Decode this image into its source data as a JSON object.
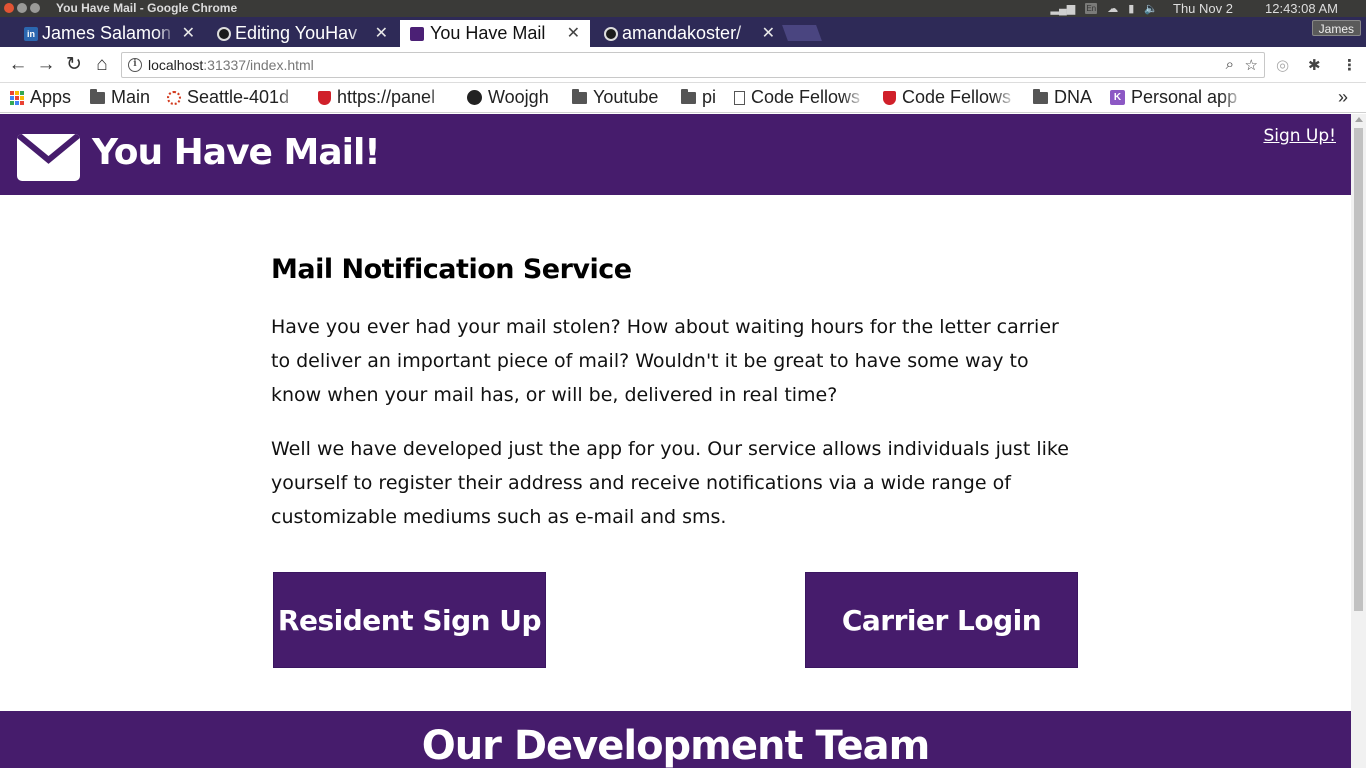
{
  "os": {
    "window_title": "You Have Mail - Google Chrome",
    "keyboard": "En",
    "date": "Thu Nov  2",
    "time": "12:43:08 AM"
  },
  "browser": {
    "tabs": [
      {
        "title": "James Salamon",
        "favicon": "linkedin-icon",
        "active": false
      },
      {
        "title": "Editing YouHav",
        "favicon": "github-icon",
        "active": false
      },
      {
        "title": "You Have Mail",
        "favicon": "mail-icon",
        "active": true
      },
      {
        "title": "amandakoster/",
        "favicon": "github-icon",
        "active": false
      }
    ],
    "profile": "James",
    "url_host": "localhost",
    "url_rest": ":31337/index.html",
    "bookmarks": [
      {
        "label": "Apps",
        "icon": "apps-grid-icon"
      },
      {
        "label": "Main",
        "icon": "folder-icon"
      },
      {
        "label": "Seattle-401d",
        "icon": "ring-icon"
      },
      {
        "label": "https://panel",
        "icon": "shield-icon"
      },
      {
        "label": "Woojgh",
        "icon": "github-icon"
      },
      {
        "label": "Youtube",
        "icon": "folder-icon"
      },
      {
        "label": "pi",
        "icon": "folder-icon"
      },
      {
        "label": "Code Fellows",
        "icon": "page-icon"
      },
      {
        "label": "Code Fellows",
        "icon": "shield-icon"
      },
      {
        "label": "DNA",
        "icon": "folder-icon"
      },
      {
        "label": "Personal app",
        "icon": "k-badge-icon"
      }
    ],
    "bookmarks_overflow": "»"
  },
  "site": {
    "title": "You Have Mail!",
    "signup_link": "Sign Up!",
    "section_heading": "Mail Notification Service",
    "paragraph1": "Have you ever had your mail stolen? How about waiting hours for the letter carrier to deliver an important piece of mail? Wouldn't it be great to have some way to know when your mail has, or will be, delivered in real time?",
    "paragraph2": "Well we have developed just the app for you. Our service allows individuals just like yourself to register their address and receive notifications via a wide range of customizable mediums such as e-mail and sms.",
    "resident_button": "Resident Sign Up",
    "carrier_button": "Carrier Login",
    "team_heading": "Our Development Team",
    "brand_color": "#461c6c"
  }
}
